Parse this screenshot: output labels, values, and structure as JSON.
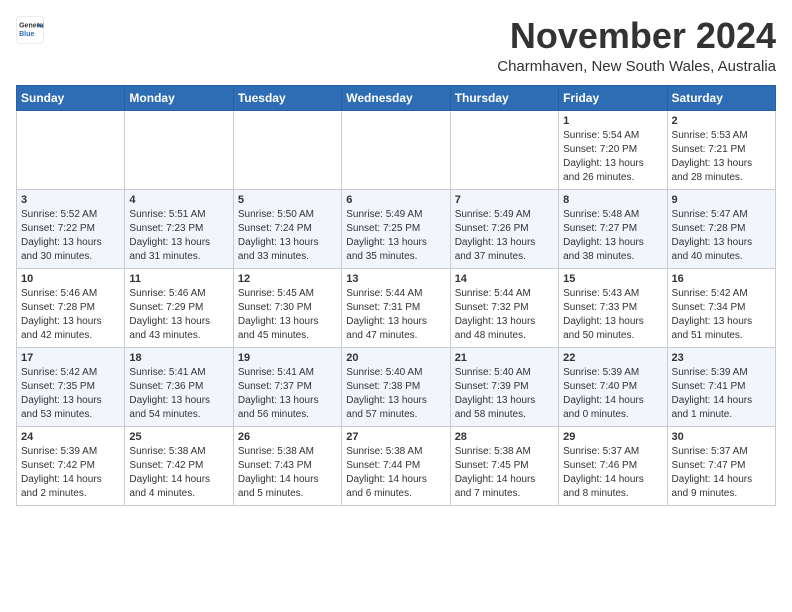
{
  "header": {
    "logo_general": "General",
    "logo_blue": "Blue",
    "month_title": "November 2024",
    "subtitle": "Charmhaven, New South Wales, Australia"
  },
  "days_of_week": [
    "Sunday",
    "Monday",
    "Tuesday",
    "Wednesday",
    "Thursday",
    "Friday",
    "Saturday"
  ],
  "weeks": [
    [
      {
        "day": "",
        "info": ""
      },
      {
        "day": "",
        "info": ""
      },
      {
        "day": "",
        "info": ""
      },
      {
        "day": "",
        "info": ""
      },
      {
        "day": "",
        "info": ""
      },
      {
        "day": "1",
        "info": "Sunrise: 5:54 AM\nSunset: 7:20 PM\nDaylight: 13 hours\nand 26 minutes."
      },
      {
        "day": "2",
        "info": "Sunrise: 5:53 AM\nSunset: 7:21 PM\nDaylight: 13 hours\nand 28 minutes."
      }
    ],
    [
      {
        "day": "3",
        "info": "Sunrise: 5:52 AM\nSunset: 7:22 PM\nDaylight: 13 hours\nand 30 minutes."
      },
      {
        "day": "4",
        "info": "Sunrise: 5:51 AM\nSunset: 7:23 PM\nDaylight: 13 hours\nand 31 minutes."
      },
      {
        "day": "5",
        "info": "Sunrise: 5:50 AM\nSunset: 7:24 PM\nDaylight: 13 hours\nand 33 minutes."
      },
      {
        "day": "6",
        "info": "Sunrise: 5:49 AM\nSunset: 7:25 PM\nDaylight: 13 hours\nand 35 minutes."
      },
      {
        "day": "7",
        "info": "Sunrise: 5:49 AM\nSunset: 7:26 PM\nDaylight: 13 hours\nand 37 minutes."
      },
      {
        "day": "8",
        "info": "Sunrise: 5:48 AM\nSunset: 7:27 PM\nDaylight: 13 hours\nand 38 minutes."
      },
      {
        "day": "9",
        "info": "Sunrise: 5:47 AM\nSunset: 7:28 PM\nDaylight: 13 hours\nand 40 minutes."
      }
    ],
    [
      {
        "day": "10",
        "info": "Sunrise: 5:46 AM\nSunset: 7:28 PM\nDaylight: 13 hours\nand 42 minutes."
      },
      {
        "day": "11",
        "info": "Sunrise: 5:46 AM\nSunset: 7:29 PM\nDaylight: 13 hours\nand 43 minutes."
      },
      {
        "day": "12",
        "info": "Sunrise: 5:45 AM\nSunset: 7:30 PM\nDaylight: 13 hours\nand 45 minutes."
      },
      {
        "day": "13",
        "info": "Sunrise: 5:44 AM\nSunset: 7:31 PM\nDaylight: 13 hours\nand 47 minutes."
      },
      {
        "day": "14",
        "info": "Sunrise: 5:44 AM\nSunset: 7:32 PM\nDaylight: 13 hours\nand 48 minutes."
      },
      {
        "day": "15",
        "info": "Sunrise: 5:43 AM\nSunset: 7:33 PM\nDaylight: 13 hours\nand 50 minutes."
      },
      {
        "day": "16",
        "info": "Sunrise: 5:42 AM\nSunset: 7:34 PM\nDaylight: 13 hours\nand 51 minutes."
      }
    ],
    [
      {
        "day": "17",
        "info": "Sunrise: 5:42 AM\nSunset: 7:35 PM\nDaylight: 13 hours\nand 53 minutes."
      },
      {
        "day": "18",
        "info": "Sunrise: 5:41 AM\nSunset: 7:36 PM\nDaylight: 13 hours\nand 54 minutes."
      },
      {
        "day": "19",
        "info": "Sunrise: 5:41 AM\nSunset: 7:37 PM\nDaylight: 13 hours\nand 56 minutes."
      },
      {
        "day": "20",
        "info": "Sunrise: 5:40 AM\nSunset: 7:38 PM\nDaylight: 13 hours\nand 57 minutes."
      },
      {
        "day": "21",
        "info": "Sunrise: 5:40 AM\nSunset: 7:39 PM\nDaylight: 13 hours\nand 58 minutes."
      },
      {
        "day": "22",
        "info": "Sunrise: 5:39 AM\nSunset: 7:40 PM\nDaylight: 14 hours\nand 0 minutes."
      },
      {
        "day": "23",
        "info": "Sunrise: 5:39 AM\nSunset: 7:41 PM\nDaylight: 14 hours\nand 1 minute."
      }
    ],
    [
      {
        "day": "24",
        "info": "Sunrise: 5:39 AM\nSunset: 7:42 PM\nDaylight: 14 hours\nand 2 minutes."
      },
      {
        "day": "25",
        "info": "Sunrise: 5:38 AM\nSunset: 7:42 PM\nDaylight: 14 hours\nand 4 minutes."
      },
      {
        "day": "26",
        "info": "Sunrise: 5:38 AM\nSunset: 7:43 PM\nDaylight: 14 hours\nand 5 minutes."
      },
      {
        "day": "27",
        "info": "Sunrise: 5:38 AM\nSunset: 7:44 PM\nDaylight: 14 hours\nand 6 minutes."
      },
      {
        "day": "28",
        "info": "Sunrise: 5:38 AM\nSunset: 7:45 PM\nDaylight: 14 hours\nand 7 minutes."
      },
      {
        "day": "29",
        "info": "Sunrise: 5:37 AM\nSunset: 7:46 PM\nDaylight: 14 hours\nand 8 minutes."
      },
      {
        "day": "30",
        "info": "Sunrise: 5:37 AM\nSunset: 7:47 PM\nDaylight: 14 hours\nand 9 minutes."
      }
    ]
  ]
}
